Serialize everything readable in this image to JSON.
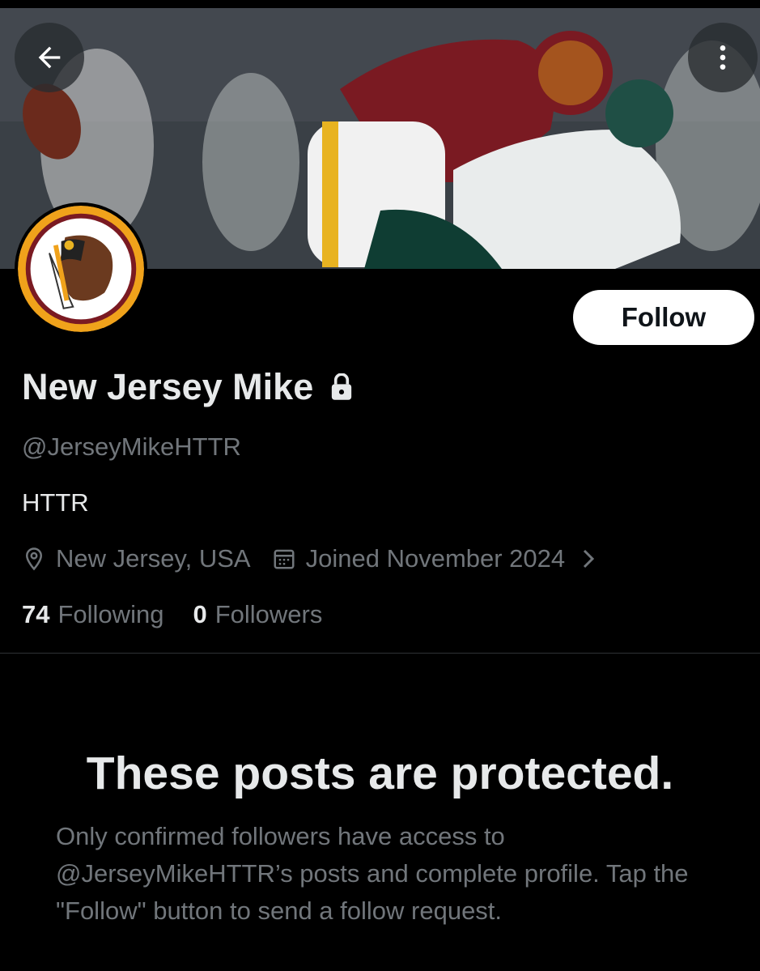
{
  "header": {
    "back_icon": "arrow-left-icon",
    "more_icon": "more-vertical-icon"
  },
  "profile": {
    "display_name": "New Jersey Mike",
    "handle": "@JerseyMikeHTTR",
    "bio": "HTTR",
    "location": "New Jersey, USA",
    "joined": "Joined November 2024",
    "following_count": "74",
    "following_label": "Following",
    "followers_count": "0",
    "followers_label": "Followers",
    "protected_icon": "lock-icon"
  },
  "actions": {
    "follow_label": "Follow"
  },
  "protected_notice": {
    "title": "These posts are protected.",
    "body": "Only confirmed followers have access to @JerseyMikeHTTR’s posts and complete profile. Tap the \"Follow\" button to send a follow request."
  },
  "colors": {
    "background": "#000000",
    "primary_text": "#e7e9ea",
    "secondary_text": "#71767b",
    "button_bg": "#ffffff",
    "divider": "#2f3336"
  }
}
